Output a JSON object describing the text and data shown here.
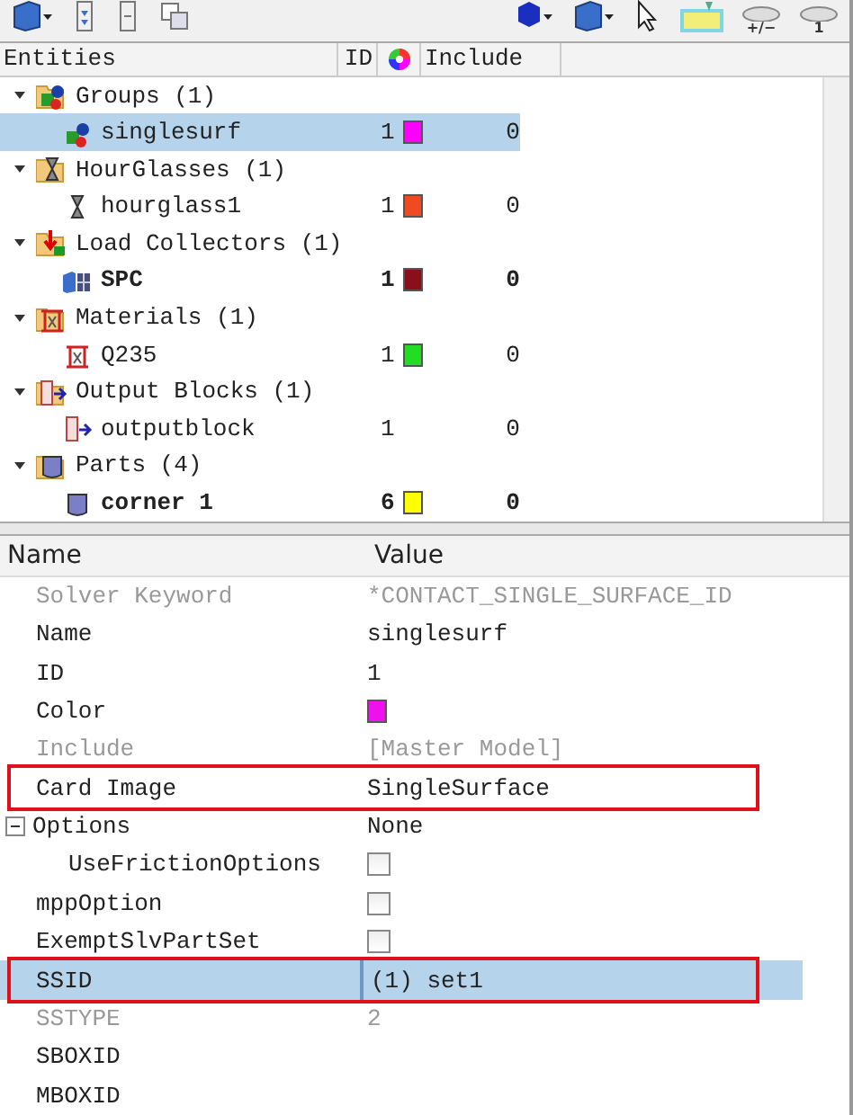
{
  "toolbar": {
    "left": [
      {
        "kind": "cube-menu"
      },
      {
        "kind": "expand"
      },
      {
        "kind": "collapse"
      },
      {
        "kind": "copy"
      }
    ],
    "right": [
      {
        "kind": "solid-menu"
      },
      {
        "kind": "cube-menu"
      },
      {
        "kind": "pointer"
      },
      {
        "kind": "highlight"
      },
      {
        "kind": "eye",
        "label": "+/−"
      },
      {
        "kind": "eye",
        "label": "1"
      }
    ]
  },
  "tree": {
    "columns": [
      "Entities",
      "ID",
      "Include"
    ],
    "groups": [
      {
        "label": "Groups (1)",
        "kind": "groups",
        "expanded": true,
        "children": [
          {
            "label": "singlesurf",
            "kind": "groups",
            "id": "1",
            "color": "#ff00ff",
            "include": "0",
            "current": false,
            "selected": true
          }
        ]
      },
      {
        "label": "HourGlasses (1)",
        "kind": "hourglass",
        "expanded": true,
        "children": [
          {
            "label": "hourglass1",
            "kind": "hourglass",
            "id": "1",
            "color": "#f04a22",
            "include": "0",
            "current": false,
            "selected": false
          }
        ]
      },
      {
        "label": "Load Collectors (1)",
        "kind": "load",
        "expanded": true,
        "children": [
          {
            "label": "SPC",
            "kind": "component",
            "id": "1",
            "color": "#8b0f1a",
            "include": "0",
            "current": true,
            "selected": false
          }
        ]
      },
      {
        "label": "Materials (1)",
        "kind": "material",
        "expanded": true,
        "children": [
          {
            "label": "Q235",
            "kind": "material",
            "id": "1",
            "color": "#22dd22",
            "include": "0",
            "current": false,
            "selected": false
          }
        ]
      },
      {
        "label": "Output Blocks (1)",
        "kind": "output",
        "expanded": true,
        "children": [
          {
            "label": "outputblock",
            "kind": "output",
            "id": "1",
            "include": "0",
            "current": false,
            "selected": false
          }
        ]
      },
      {
        "label": "Parts (4)",
        "kind": "part",
        "expanded": true,
        "children": [
          {
            "label": "corner 1",
            "kind": "part",
            "id": "6",
            "color": "#ffff00",
            "include": "0",
            "current": true,
            "selected": false
          }
        ]
      }
    ]
  },
  "properties": {
    "columns": [
      "Name",
      "Value"
    ],
    "rows": [
      {
        "kind": "text",
        "name": "Solver Keyword",
        "value": "*CONTACT_SINGLE_SURFACE_ID",
        "disabled": true,
        "selected": false,
        "annotated": false
      },
      {
        "kind": "text",
        "name": "Name",
        "value": "singlesurf",
        "disabled": false,
        "selected": false,
        "annotated": false
      },
      {
        "kind": "text",
        "name": "ID",
        "value": "1",
        "disabled": false,
        "selected": false,
        "annotated": false
      },
      {
        "kind": "color",
        "name": "Color",
        "color": "#ee11ee",
        "disabled": false,
        "selected": false,
        "annotated": false
      },
      {
        "kind": "text",
        "name": "Include",
        "value": "[Master Model]",
        "disabled": true,
        "selected": false,
        "annotated": false
      },
      {
        "kind": "text",
        "name": "Card Image",
        "value": "SingleSurface",
        "disabled": false,
        "selected": false,
        "annotated": true
      },
      {
        "kind": "group",
        "name": "Options",
        "value": "None",
        "expanded": true,
        "disabled": false,
        "selected": false,
        "annotated": false,
        "children": [
          {
            "kind": "checkbox",
            "name": "UseFrictionOptions",
            "checked": false,
            "disabled": false,
            "selected": false,
            "annotated": false
          }
        ]
      },
      {
        "kind": "checkbox",
        "name": "mppOption",
        "checked": false,
        "disabled": false,
        "selected": false,
        "annotated": false
      },
      {
        "kind": "checkbox",
        "name": "ExemptSlvPartSet",
        "checked": false,
        "disabled": false,
        "selected": false,
        "annotated": false
      },
      {
        "kind": "text",
        "name": "SSID",
        "value": "(1) set1",
        "disabled": false,
        "selected": true,
        "annotated": true
      },
      {
        "kind": "text",
        "name": "SSTYPE",
        "value": "2",
        "disabled": true,
        "selected": false,
        "annotated": false
      },
      {
        "kind": "text",
        "name": "SBOXID",
        "disabled": false,
        "selected": false,
        "annotated": false
      },
      {
        "kind": "text",
        "name": "MBOXID",
        "disabled": false,
        "selected": false,
        "annotated": false
      }
    ]
  }
}
